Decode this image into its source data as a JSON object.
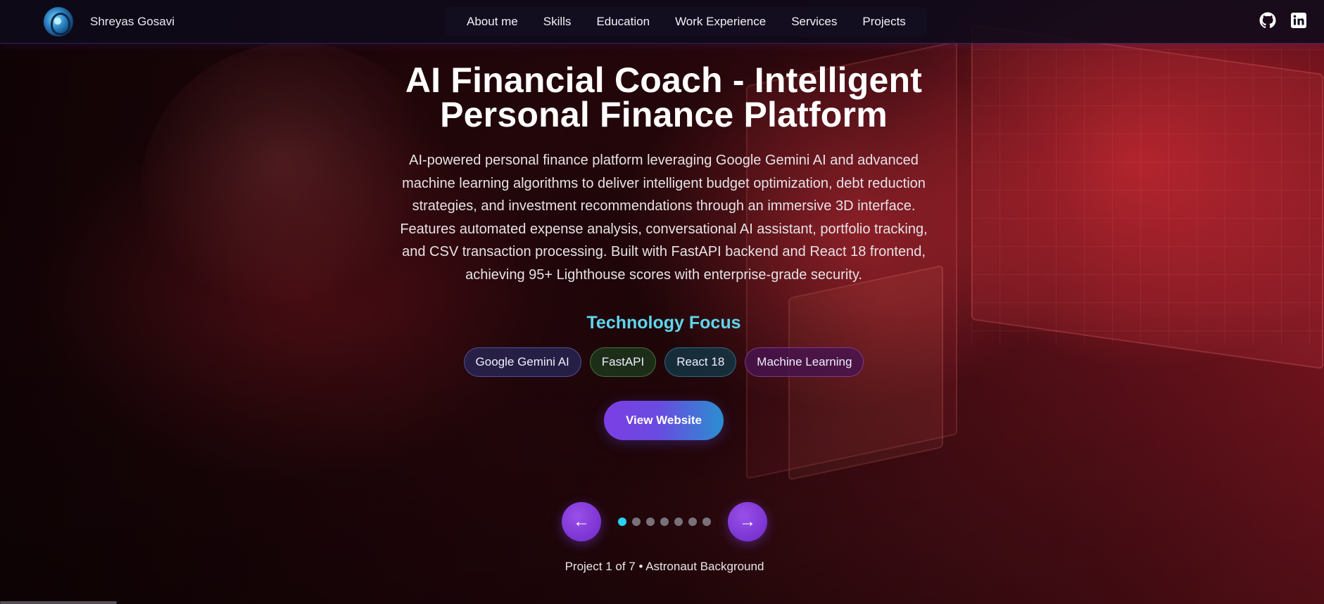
{
  "brand": {
    "name": "Shreyas Gosavi",
    "logo_icon": "atom-logo-icon"
  },
  "nav": {
    "items": [
      {
        "label": "About me"
      },
      {
        "label": "Skills"
      },
      {
        "label": "Education"
      },
      {
        "label": "Work Experience"
      },
      {
        "label": "Services"
      },
      {
        "label": "Projects"
      }
    ]
  },
  "socials": [
    {
      "icon": "github-icon"
    },
    {
      "icon": "linkedin-icon"
    }
  ],
  "project": {
    "title_line1": "AI Financial Coach - Intelligent",
    "title_line2": "Personal Finance Platform",
    "description": "AI-powered personal finance platform leveraging Google Gemini AI and advanced machine learning algorithms to deliver intelligent budget optimization, debt reduction strategies, and investment recommendations through an immersive 3D interface. Features automated expense analysis, conversational AI assistant, portfolio tracking, and CSV transaction processing. Built with FastAPI backend and React 18 frontend, achieving 95+ Lighthouse scores with enterprise-grade security.",
    "tech_heading": "Technology Focus",
    "tags": [
      "Google Gemini AI",
      "FastAPI",
      "React 18",
      "Machine Learning"
    ],
    "cta_label": "View Website"
  },
  "carousel": {
    "prev_label": "←",
    "next_label": "→",
    "current": 1,
    "total": 7,
    "counter_text": "Project 1 of 7 • Astronaut Background"
  },
  "colors": {
    "accent_cyan": "#5fd6ee",
    "active_dot": "#2ad3f0",
    "button_purple": "#7b3fe4",
    "button_blue": "#2a8fd0"
  }
}
